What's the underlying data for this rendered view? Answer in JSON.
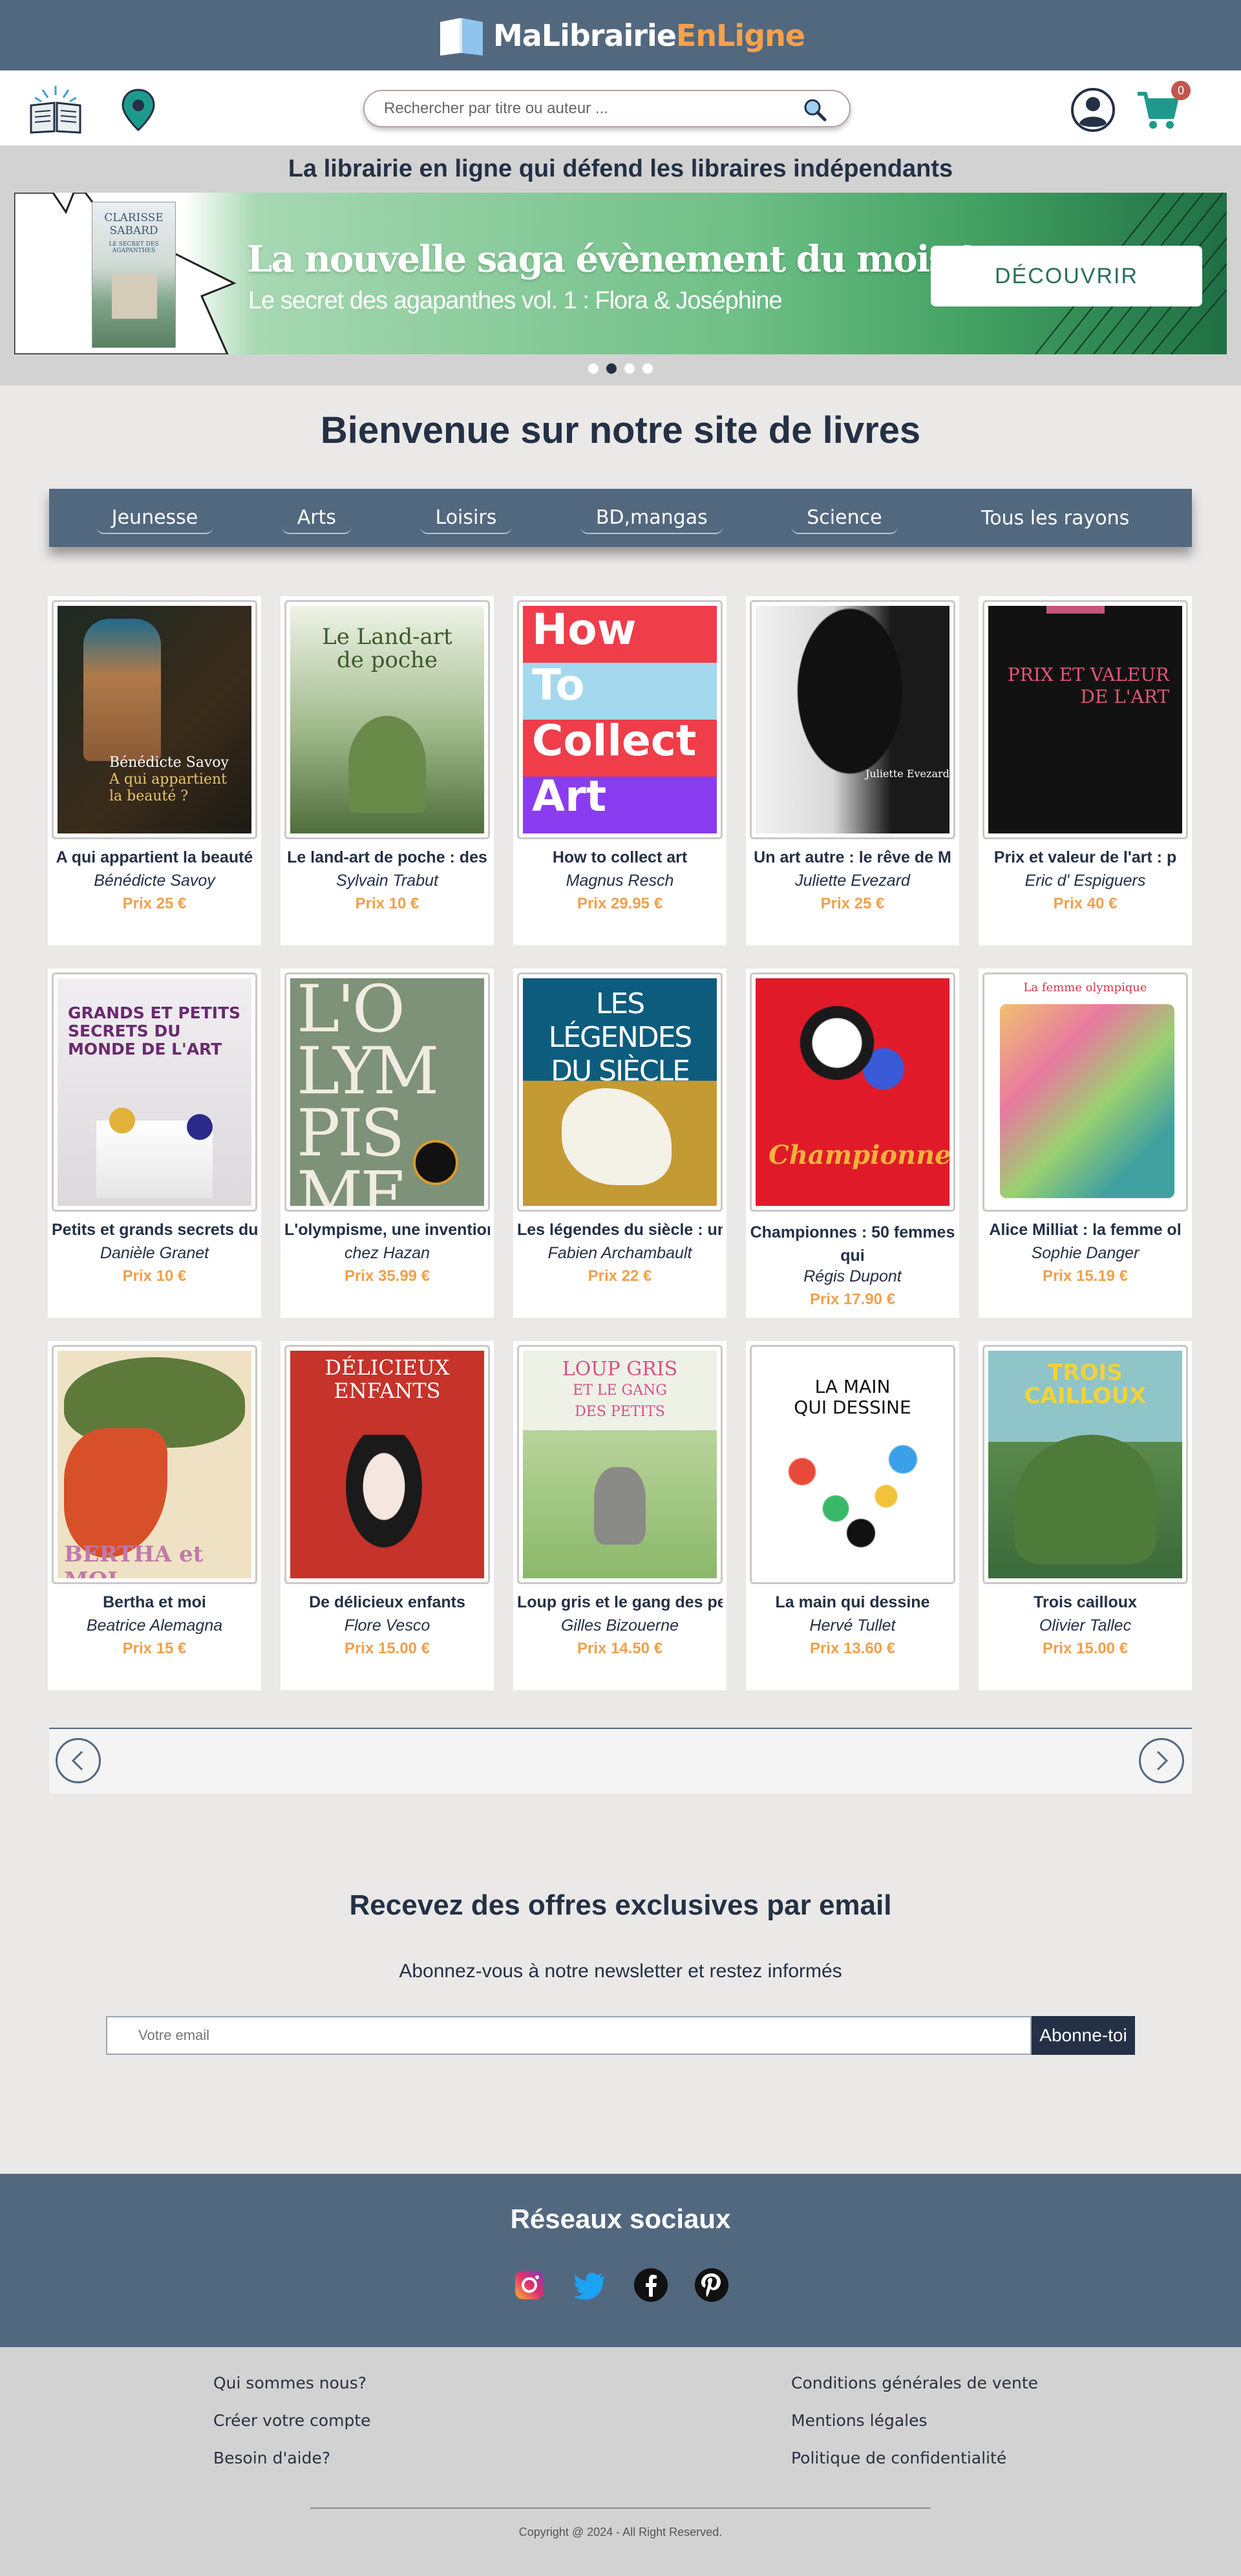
{
  "header": {
    "logo_part1": "MaLibrairie",
    "logo_part2": "EnLigne",
    "brand_colors": {
      "bar": "#52687f",
      "accent": "#f5a14e",
      "text_dark": "#243045"
    }
  },
  "nav": {
    "search_placeholder": "Rechercher par titre ou auteur ...",
    "cart_count": "0",
    "icons": [
      "open-book-icon",
      "location-pin-icon",
      "search-icon",
      "user-icon",
      "cart-icon"
    ]
  },
  "tagline": "La librairie en ligne qui défend les libraires indépendants",
  "banner": {
    "title": "La nouvelle saga évènement du mois !",
    "subtitle": "Le secret des agapanthes vol. 1 : Flora & Joséphine",
    "button": "DÉCOUVRIR",
    "book_author": "CLARISSE SABARD",
    "book_title": "LE SECRET DES AGAPANTHES",
    "slides": 4,
    "active_slide": 2
  },
  "welcome": "Bienvenue sur notre site de livres",
  "categories": [
    "Jeunesse",
    "Arts",
    "Loisirs",
    "BD,mangas",
    "Science",
    "Tous les rayons"
  ],
  "books": [
    {
      "title": "A qui appartient la beauté",
      "author": "Bénédicte Savoy",
      "price": "Prix 25 €",
      "cover_text": "Bénédicte Savoy\nA qui appartient\nla beauté ?"
    },
    {
      "title": "Le land-art de poche : des",
      "author": "Sylvain Trabut",
      "price": "Prix 10 €",
      "cover_text": "Le Land-art de poche"
    },
    {
      "title": "How to collect art",
      "author": "Magnus Resch",
      "price": "Prix 29.95 €",
      "cover_text": "How To Collect Art"
    },
    {
      "title": "Un art autre : le rêve de M",
      "author": "Juliette Evezard",
      "price": "Prix 25 €",
      "cover_text": "Juliette Evezard"
    },
    {
      "title": "Prix et valeur de l'art : p",
      "author": "Eric d' Espiguers",
      "price": "Prix 40 €",
      "cover_text": "PRIX ET VALEUR DE L'ART"
    },
    {
      "title": "Petits et grands secrets du",
      "author": "Danièle Granet",
      "price": "Prix 10 €",
      "cover_text": "GRANDS ET PETITS SECRETS DU MONDE DE L'ART"
    },
    {
      "title": "L'olympisme, une invention",
      "author": "chez Hazan",
      "price": "Prix 35.99 €",
      "cover_text": "L'OLYMPISME"
    },
    {
      "title": "Les légendes du siècle : un",
      "author": "Fabien Archambault",
      "price": "Prix 22 €",
      "cover_text": "LES LÉGENDES DU SIÈCLE"
    },
    {
      "title": "Championnes : 50 femmes qui",
      "author": "Régis Dupont",
      "price": "Prix 17.90 €",
      "cover_text": "Championnes",
      "tall": true
    },
    {
      "title": "Alice Milliat : la femme ol",
      "author": "Sophie Danger",
      "price": "Prix 15.19 €",
      "cover_text": "La femme olympique"
    },
    {
      "title": "Bertha et moi",
      "author": "Beatrice Alemagna",
      "price": "Prix 15 €",
      "cover_text": "BERTHA et MOI"
    },
    {
      "title": "De délicieux enfants",
      "author": "Flore Vesco",
      "price": "Prix 15.00 €",
      "cover_text": "DÉLICIEUX ENFANTS"
    },
    {
      "title": "Loup gris et le gang des pe",
      "author": "Gilles Bizouerne",
      "price": "Prix 14.50 €",
      "cover_text": "LOUP GRIS ET LE GANG DES PETITS"
    },
    {
      "title": "La main qui dessine",
      "author": "Hervé Tullet",
      "price": "Prix 13.60 €",
      "cover_text": "LA MAIN QUI DESSINE"
    },
    {
      "title": "Trois cailloux",
      "author": "Olivier Tallec",
      "price": "Prix 15.00 €",
      "cover_text": "TROIS CAILLOUX"
    }
  ],
  "newsletter": {
    "title": "Recevez des offres exclusives par email",
    "subtitle": "Abonnez-vous à notre newsletter et restez informés",
    "placeholder": "Votre email",
    "button": "Abonne-toi"
  },
  "social": {
    "title": "Réseaux sociaux",
    "icons": [
      "instagram-icon",
      "twitter-icon",
      "facebook-icon",
      "pinterest-icon"
    ]
  },
  "footer": {
    "left_links": [
      "Qui sommes nous?",
      "Créer votre compte",
      "Besoin d'aide?"
    ],
    "right_links": [
      "Conditions générales de vente",
      "Mentions légales",
      "Politique de confidentialité"
    ],
    "copyright": "Copyright @ 2024 - All Right Reserved."
  }
}
